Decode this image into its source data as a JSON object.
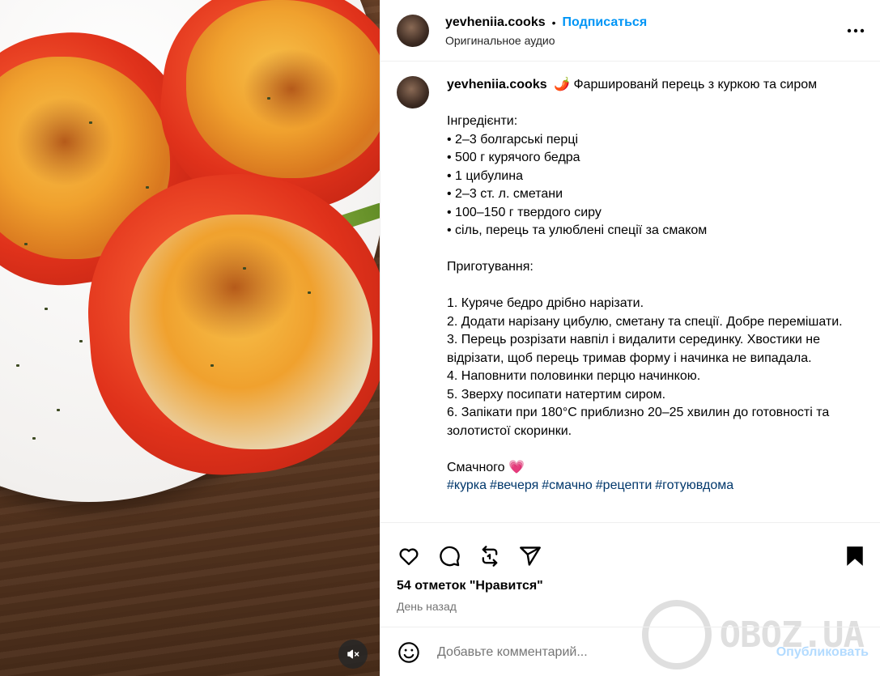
{
  "header": {
    "username": "yevheniia.cooks",
    "dot": "•",
    "follow_label": "Подписаться",
    "audio_label": "Оригинальное аудио",
    "more_icon": "more-horizontal-icon"
  },
  "caption": {
    "username": "yevheniia.cooks",
    "title": "🌶️ Фаршированй перець з куркою та сиром",
    "ingredients_heading": "Інгредієнти:",
    "ingredients": [
      "• 2–3 болгарські перці",
      "• 500 г курячого бедра",
      "• 1 цибулина",
      "• 2–3 ст. л. сметани",
      "• 100–150 г твердого сиру",
      "• сіль, перець та улюблені спеції за смаком"
    ],
    "steps_heading": "Приготування:",
    "steps": [
      "1. Куряче бедро дрібно нарізати.",
      "2. Додати нарізану цибулю, сметану та спеції. Добре перемішати.",
      "3. Перець розрізати навпіл і видалити серединку. Хвостики не відрізати, щоб перець тримав форму і начинка не випадала.",
      "4. Наповнити половинки перцю начинкою.",
      "5. Зверху посипати натертим сиром.",
      "6. Запікати при 180°C приблизно 20–25 хвилин до готовності та золотистої скоринки."
    ],
    "closing": "Смачного 💗",
    "hashtags": [
      "#курка",
      "#вечеря",
      "#смачно",
      "#рецепти",
      "#готуювдома"
    ]
  },
  "actions": {
    "likes_text": "54 отметок \"Нравится\"",
    "time_text": "День назад",
    "icons": [
      "heart-icon",
      "comment-icon",
      "repost-icon",
      "share-icon",
      "bookmark-icon"
    ]
  },
  "comment": {
    "placeholder": "Добавьте комментарий...",
    "publish_label": "Опубликовать"
  },
  "watermark": {
    "text": "OBOZ.UA"
  },
  "media": {
    "mute_icon": "speaker-muted-icon"
  },
  "colors": {
    "accent": "#0095f6",
    "publish_disabled": "#b3dbff",
    "hashtag": "#00376b",
    "muted_text": "#737373"
  }
}
